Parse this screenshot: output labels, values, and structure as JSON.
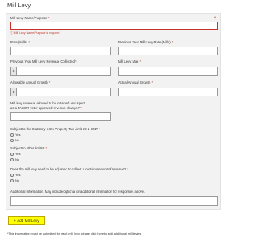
{
  "page": {
    "title": "Mill Levy"
  },
  "form": {
    "name_label": "Mill Levy Name/Purpose",
    "required_mark": "*",
    "name_error": "Mill Levy Name/Purpose is required",
    "error_icon": "error-icon",
    "rate_label": "Rate (Mills)",
    "prev_rate_label": "Previous Year Mill Levy Rate (Mills)",
    "prev_revenue_label": "Previous Year Mill Levy Revenue Collected",
    "max_label": "Mill Levy Max",
    "allowable_growth_label": "Allowable Annual Growth",
    "actual_growth_label": "Actual Annual Growth",
    "currency_symbol": "$",
    "retained_label_line1": "Mill levy revenue allowed to be retained and spent",
    "retained_label_line2": "as a TABOR voter-approved revenue change?",
    "statutory_label": "Subject to the Statutory 5.5% Property Tax Limit 29-1-301?",
    "other_limits_label": "Subject to other limits?",
    "adjusted_label": "Does the mill levy need to be adjusted to collect a certain amount of revenue?",
    "additional_info_label": "Additional Information. May include optional or additional information for responses above.",
    "yes_label": "Yes",
    "no_label": "No"
  },
  "actions": {
    "add_label": "+ Add Mill Levy"
  },
  "footnote": "*This information must be submitted for each mill levy, please click here to add additional mill levies."
}
